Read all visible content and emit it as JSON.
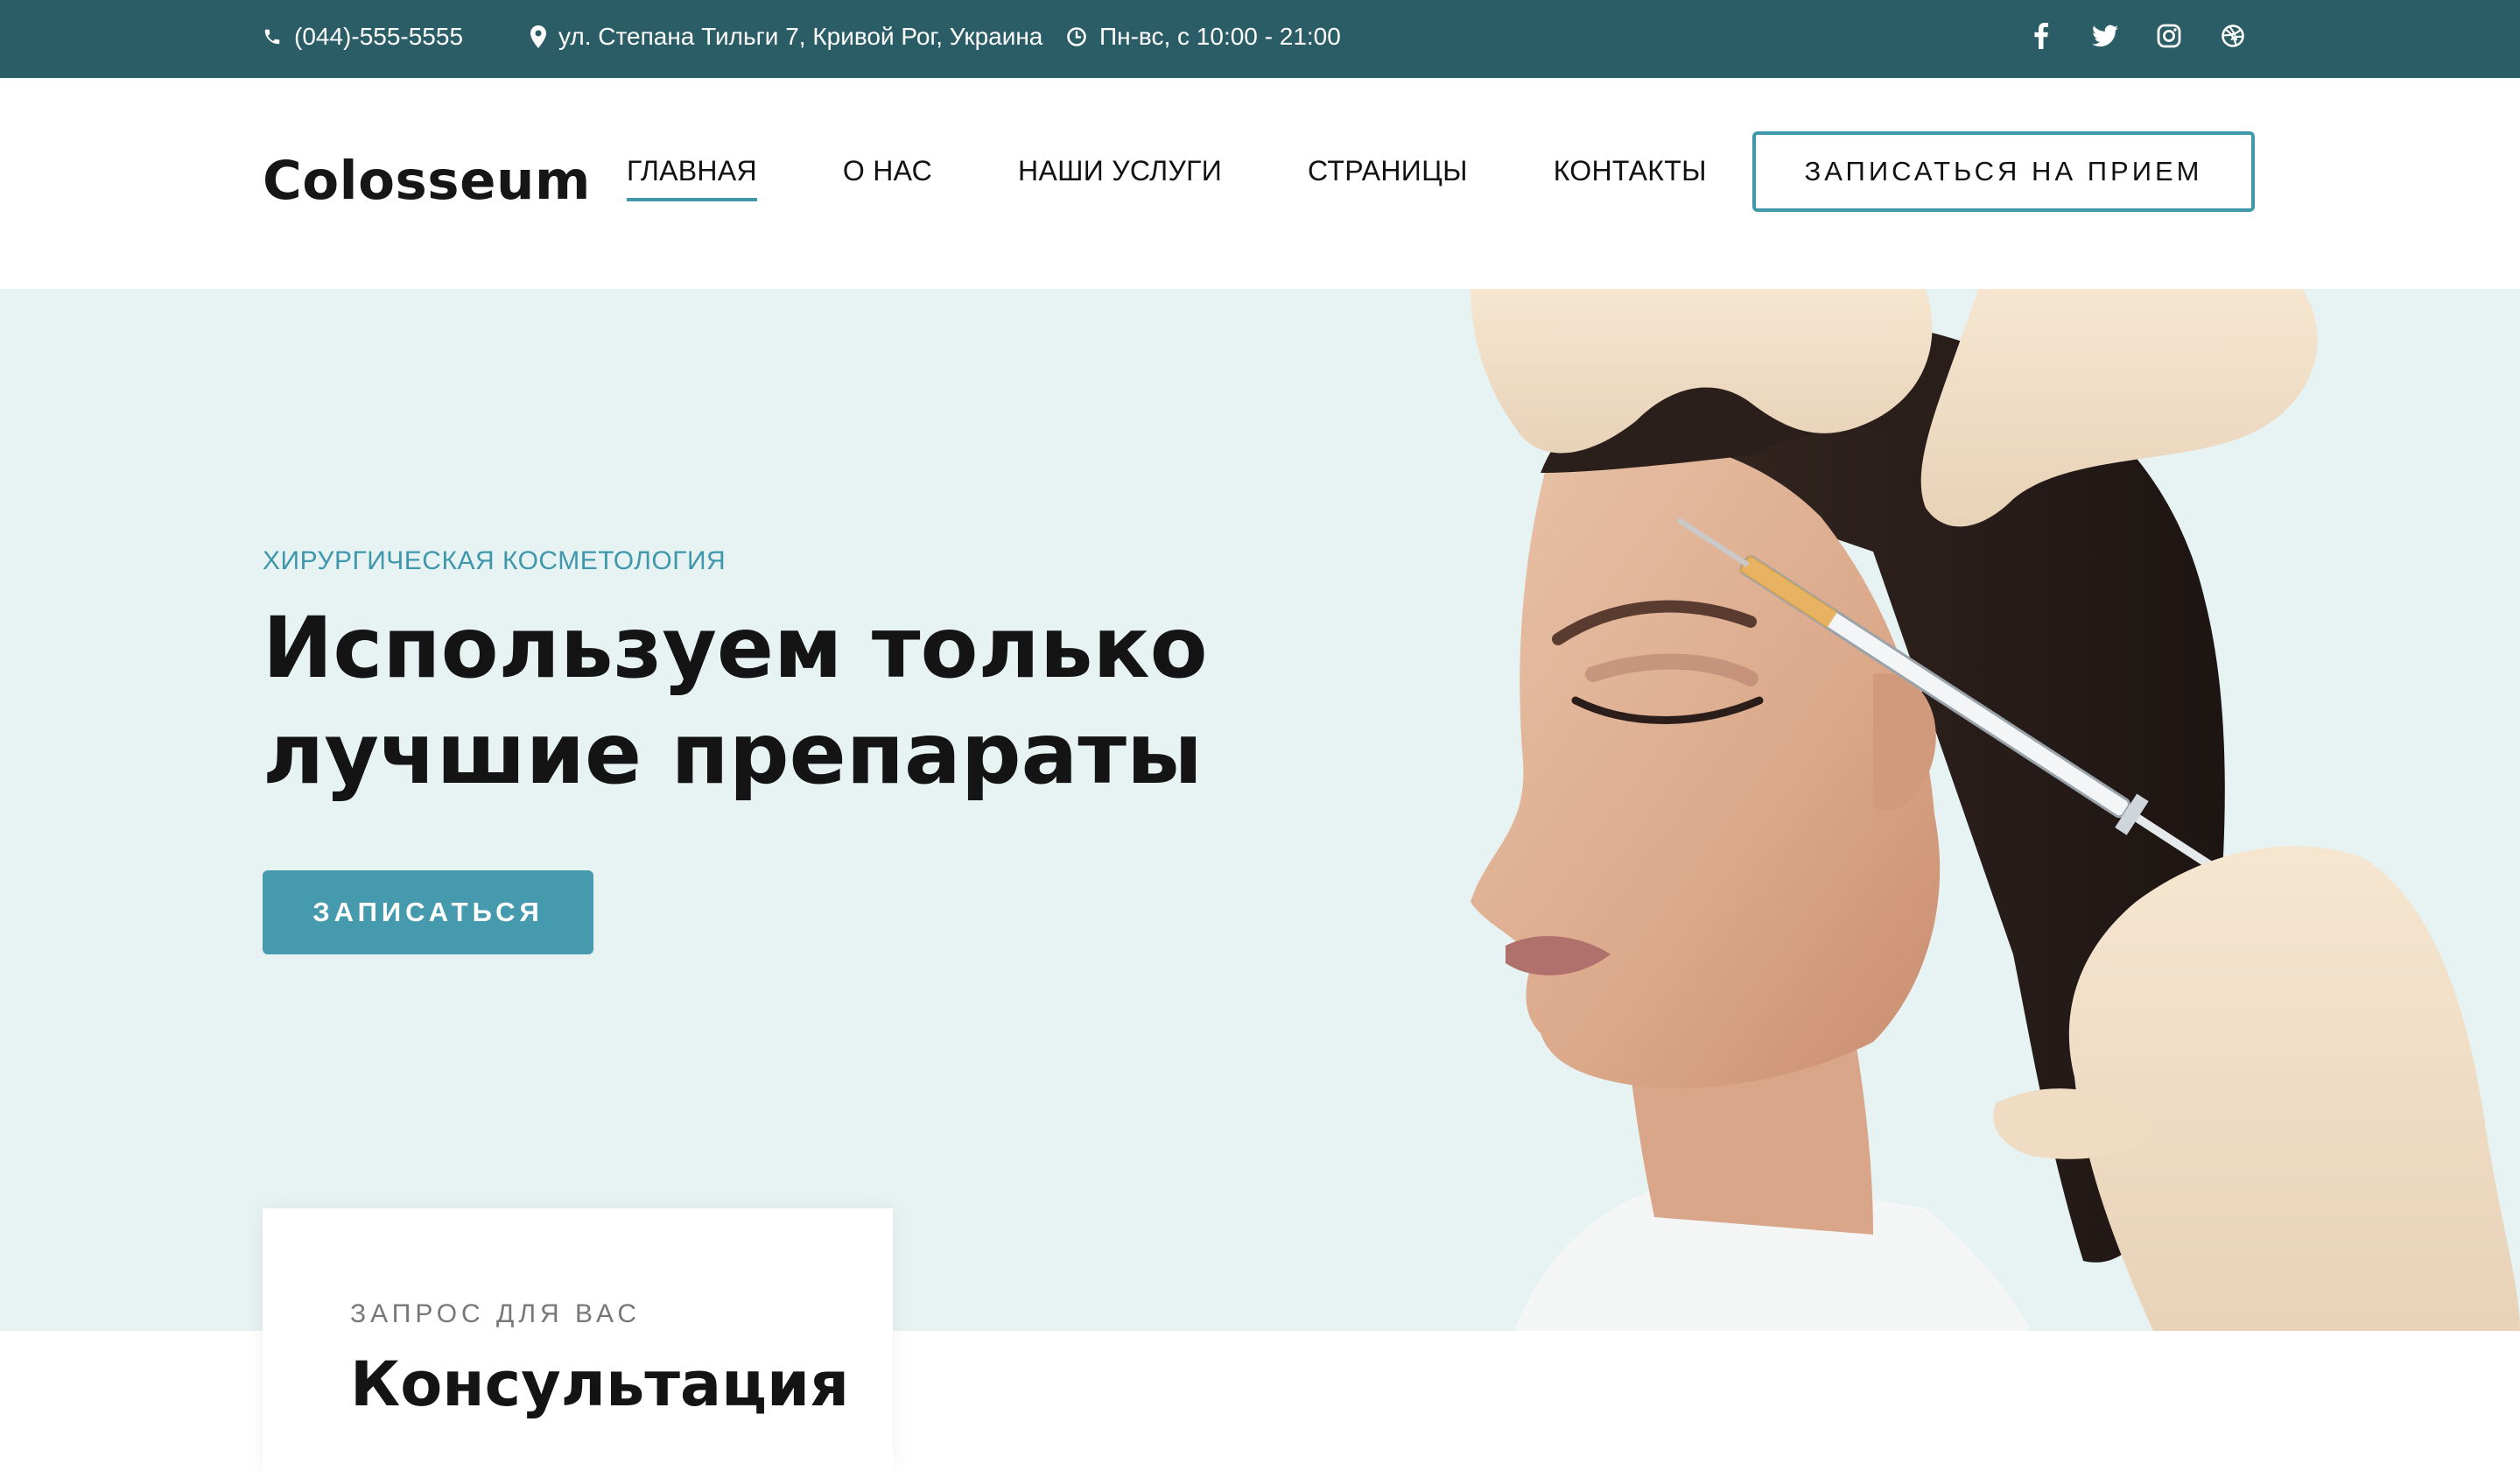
{
  "topbar": {
    "phone": "(044)-555-5555",
    "address": "ул. Степана Тильги 7, Кривой Рог, Украина",
    "hours": "Пн-вс, с 10:00 - 21:00",
    "icons": {
      "phone": "phone-icon",
      "address": "map-pin-icon",
      "hours": "clock-icon"
    },
    "socials": [
      "facebook-icon",
      "twitter-icon",
      "instagram-icon",
      "dribbble-icon"
    ]
  },
  "header": {
    "logo": "Colosseum",
    "nav": [
      {
        "label": "ГЛАВНАЯ",
        "active": true
      },
      {
        "label": "О НАС",
        "active": false
      },
      {
        "label": "НАШИ УСЛУГИ",
        "active": false
      },
      {
        "label": "СТРАНИЦЫ",
        "active": false
      },
      {
        "label": "КОНТАКТЫ",
        "active": false
      }
    ],
    "cta_label": "ЗАПИСАТЬСЯ НА ПРИЕМ"
  },
  "hero": {
    "eyebrow": "ХИРУРГИЧЕСКАЯ КОСМЕТОЛОГИЯ",
    "headline_line1": "Используем только",
    "headline_line2": "лучшие препараты",
    "button_label": "ЗАПИСАТЬСЯ"
  },
  "card": {
    "eyebrow": "ЗАПРОС ДЛЯ ВАС",
    "title": "Консультация"
  },
  "colors": {
    "topbar": "#2a5d66",
    "accent": "#3f97ab",
    "button": "#459aad",
    "hero_bg": "#e7f3f3"
  }
}
